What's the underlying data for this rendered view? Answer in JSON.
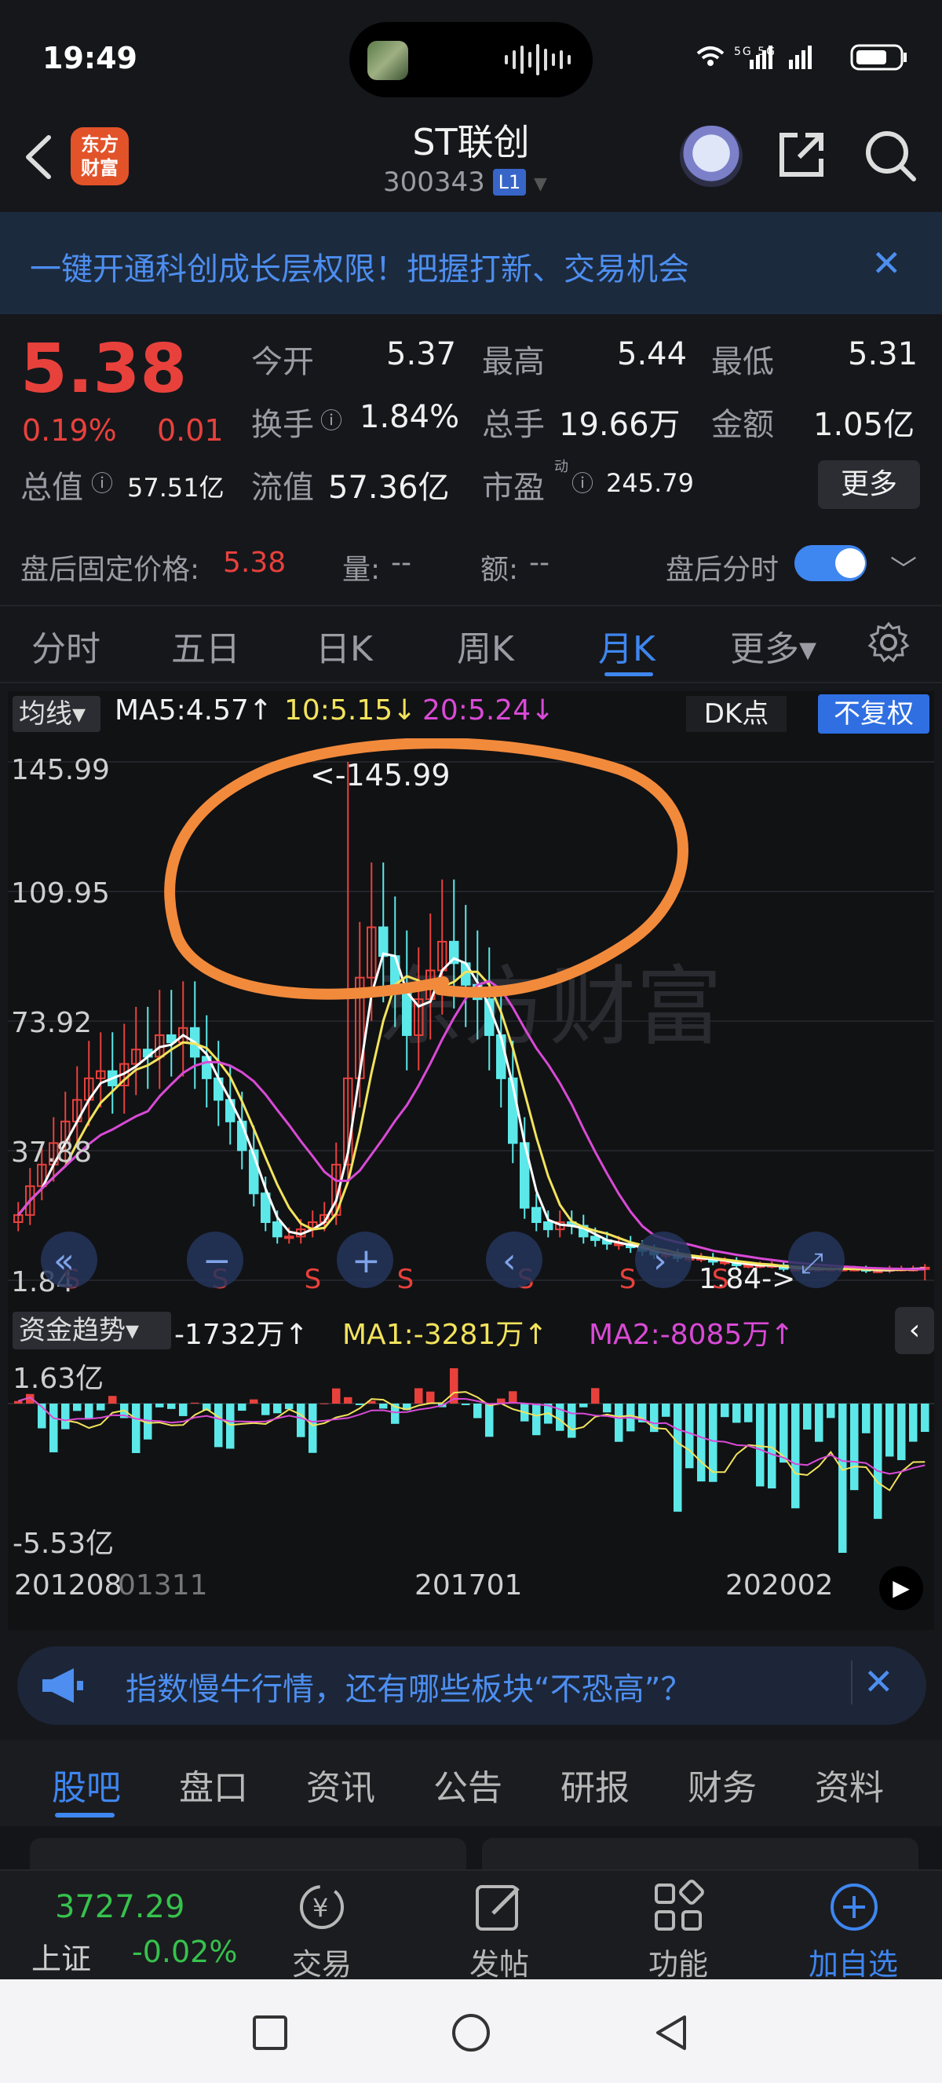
{
  "status_bar": {
    "time": "19:49",
    "icons": "5G 5G"
  },
  "header": {
    "logo_line1": "东方",
    "logo_line2": "财富",
    "stock_name": "ST联创",
    "stock_code": "300343",
    "level_badge": "L1"
  },
  "promo": {
    "text": "一键开通科创成长层权限！把握打新、交易机会",
    "close": "✕"
  },
  "quote": {
    "price": "5.38",
    "change_pct": "0.19%",
    "change": "0.01",
    "open_label": "今开",
    "open": "5.37",
    "high_label": "最高",
    "high": "5.44",
    "low_label": "最低",
    "low": "5.31",
    "turnover_label": "换手",
    "turnover": "1.84%",
    "volume_label": "总手",
    "volume": "19.66万",
    "amount_label": "金额",
    "amount": "1.05亿",
    "mktcap_label": "总值",
    "mktcap": "57.51亿",
    "float_label": "流值",
    "float_cap": "57.36亿",
    "pe_label": "市盈",
    "pe_sup": "动",
    "pe": "245.79",
    "more": "更多"
  },
  "after_hours": {
    "fixed_price_label": "盘后固定价格:",
    "fixed_price": "5.38",
    "vol_label": "量:",
    "vol": "--",
    "amt_label": "额:",
    "amt": "--",
    "toggle_label": "盘后分时"
  },
  "period_tabs": [
    "分时",
    "五日",
    "日K",
    "周K",
    "月K",
    "更多▾"
  ],
  "active_period": "月K",
  "chart": {
    "ma_selector": "均线▾",
    "ma5": "MA5:4.57↑",
    "ma10": "10:5.15↓",
    "ma20": "20:5.24↓",
    "dk": "DK点",
    "adjust": "不复权",
    "y_labels": [
      "145.99",
      "109.95",
      "73.92",
      "37.88",
      "1.84"
    ],
    "max_marker": "<-145.99",
    "min_marker": "1.84->",
    "s_marker": "S",
    "watermark": "东方财富",
    "colors": {
      "up": "#e8413c",
      "down": "#5ce8e8",
      "ma5": "#ffffff",
      "ma10": "#f2e35c",
      "ma20": "#d94ad6",
      "annotation": "#f28a3c"
    }
  },
  "flow": {
    "selector": "资金趋势▾",
    "value": "-1732万↑",
    "ma1": "MA1:-3281万↑",
    "ma2": "MA2:-8085万↑",
    "y_top": "1.63亿",
    "y_bottom": "-5.53亿",
    "collapse": "‹"
  },
  "x_axis": [
    "201208",
    "01311",
    "201701",
    "202002"
  ],
  "news": {
    "text": "指数慢牛行情，还有哪些板块“不恐高”？",
    "close": "✕"
  },
  "content_tabs": [
    "股吧",
    "盘口",
    "资讯",
    "公告",
    "研报",
    "财务",
    "资料"
  ],
  "active_content_tab": "股吧",
  "bottom_bar": {
    "index_value": "3727.29",
    "index_name": "上证",
    "index_change": "-0.02%",
    "items": [
      "交易",
      "发帖",
      "功能",
      "加自选"
    ]
  },
  "chart_data": {
    "type": "candlestick",
    "title": "",
    "period": "monthly",
    "ylim": [
      1.84,
      145.99
    ],
    "x_ticks": [
      "201208",
      "201701",
      "202002"
    ],
    "series": [
      {
        "name": "MA5",
        "value": 4.57
      },
      {
        "name": "MA10",
        "value": 5.15
      },
      {
        "name": "MA20",
        "value": 5.24
      }
    ],
    "closes": [
      20,
      28,
      34,
      40,
      46,
      52,
      58,
      60,
      56,
      62,
      66,
      64,
      70,
      68,
      72,
      64,
      58,
      52,
      46,
      38,
      26,
      18,
      14,
      14,
      16,
      18,
      20,
      34,
      58,
      86,
      100,
      92,
      84,
      70,
      80,
      88,
      96,
      90,
      84,
      80,
      70,
      58,
      40,
      22,
      18,
      16,
      18,
      17,
      14,
      13,
      12,
      12,
      11,
      10,
      9,
      9,
      8,
      8,
      8,
      7,
      7,
      6,
      6,
      6,
      6,
      5,
      5,
      5,
      5,
      5,
      5,
      5,
      4.5,
      4.5,
      5,
      5,
      5,
      5.38
    ],
    "max": 145.99,
    "min": 1.84
  }
}
